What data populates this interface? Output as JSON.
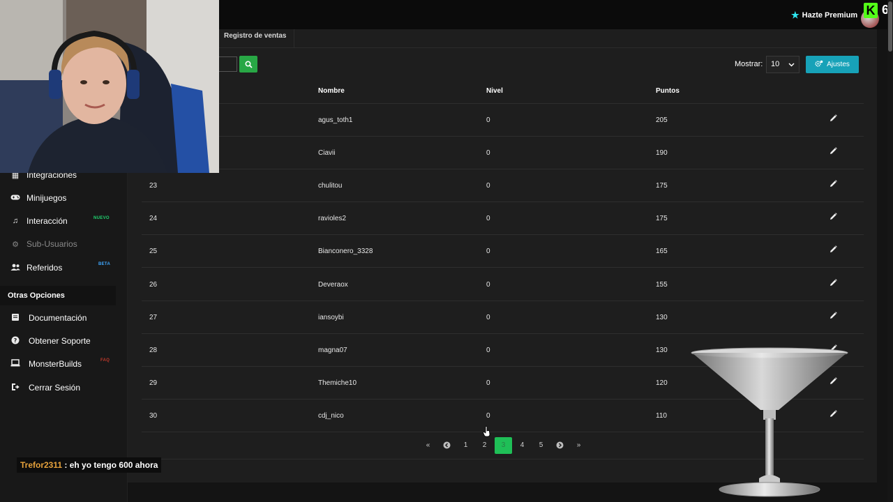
{
  "header": {
    "premium_label": "Hazte Premium",
    "brand_letter": "K",
    "corner_number": "6"
  },
  "sidebar": {
    "items": [
      {
        "label": "Integraciones",
        "icon": "grid-icon"
      },
      {
        "label": "Minijuegos",
        "icon": "gamepad-icon"
      },
      {
        "label": "Interacción",
        "icon": "music-icon",
        "tag": "NUEVO"
      },
      {
        "label": "Sub-Usuarios",
        "icon": "users-gear-icon",
        "disabled": true
      },
      {
        "label": "Referidos",
        "icon": "users-icon",
        "tag": "BETA"
      }
    ],
    "section_title": "Otras Opciones",
    "other_items": [
      {
        "label": "Documentación",
        "icon": "book-icon"
      },
      {
        "label": "Obtener Soporte",
        "icon": "question-circle-icon"
      },
      {
        "label": "MonsterBuilds",
        "icon": "laptop-icon",
        "tag": "FAQ"
      },
      {
        "label": "Cerrar Sesión",
        "icon": "sign-out-icon"
      }
    ],
    "colors": {
      "nuevo": "#1fd36f",
      "beta": "#3fa8ff"
    }
  },
  "main": {
    "tab_label": "Registro de ventas",
    "search": {
      "value": "",
      "button_icon": "search-icon"
    },
    "show_label": "Mostrar:",
    "show_value": "10",
    "settings_label": "Ajustes",
    "columns": [
      "Nombre",
      "Nivel",
      "Puntos"
    ],
    "rows": [
      {
        "pos": "",
        "name": "agus_toth1",
        "level": "0",
        "points": "205"
      },
      {
        "pos": "",
        "name": "Ciavii",
        "level": "0",
        "points": "190"
      },
      {
        "pos": "23",
        "name": "chulitou",
        "level": "0",
        "points": "175"
      },
      {
        "pos": "24",
        "name": "ravioles2",
        "level": "0",
        "points": "175"
      },
      {
        "pos": "25",
        "name": "Bianconero_3328",
        "level": "0",
        "points": "165"
      },
      {
        "pos": "26",
        "name": "Deveraox",
        "level": "0",
        "points": "155"
      },
      {
        "pos": "27",
        "name": "iansoybi",
        "level": "0",
        "points": "130"
      },
      {
        "pos": "28",
        "name": "magna07",
        "level": "0",
        "points": "130"
      },
      {
        "pos": "29",
        "name": "Themiche10",
        "level": "0",
        "points": "120"
      },
      {
        "pos": "30",
        "name": "cdj_nico",
        "level": "0",
        "points": "110"
      }
    ],
    "pagination": {
      "first": "«",
      "prev": "‹",
      "pages": [
        "1",
        "2",
        "3",
        "4",
        "5"
      ],
      "current": "3",
      "next": "›",
      "last": "»"
    },
    "colors": {
      "search": "#28a745",
      "settings": "#17a2b8",
      "active_page": "#1fbf57"
    }
  },
  "chat": {
    "user": "Trefor2311",
    "separator": " : ",
    "message": "eh yo tengo 600 ahora"
  }
}
